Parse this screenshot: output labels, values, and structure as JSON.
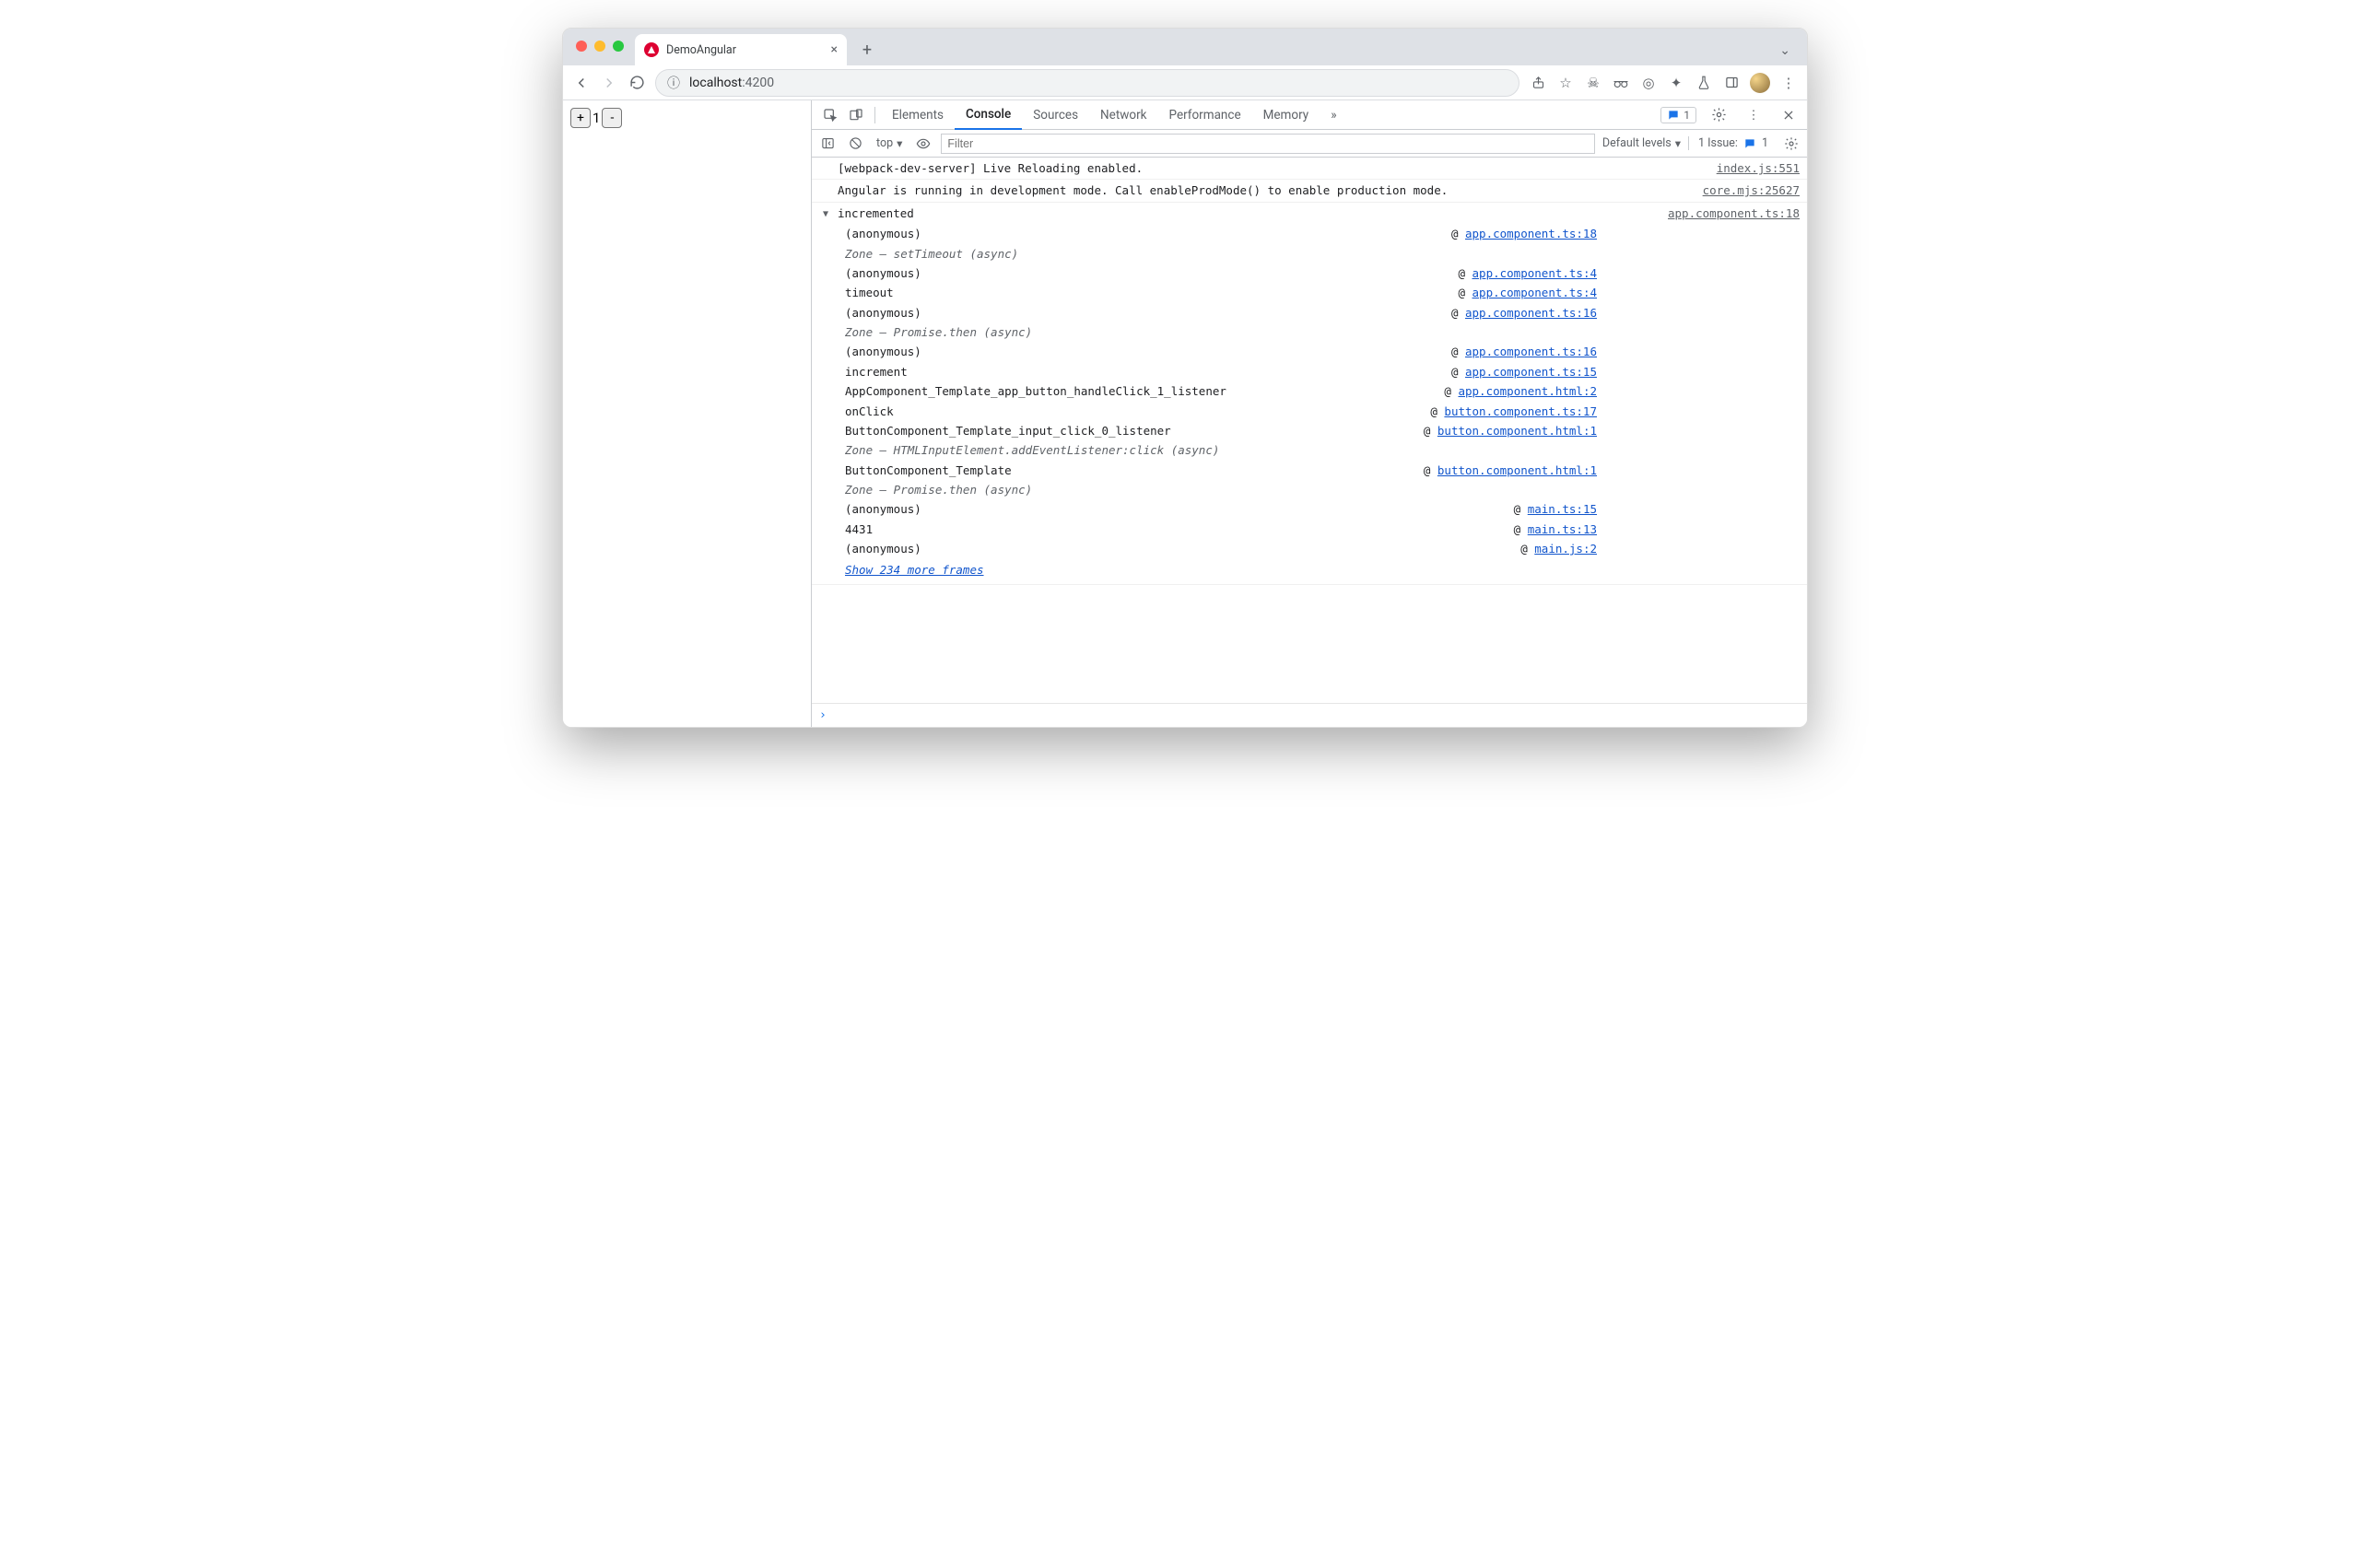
{
  "browser": {
    "tab_title": "DemoAngular",
    "url_host": "localhost",
    "url_rest": ":4200",
    "new_tab_glyph": "+",
    "close_glyph": "×"
  },
  "page": {
    "counter_value": "1",
    "plus_label": "+",
    "minus_label": "-"
  },
  "devtools": {
    "tabs": [
      "Elements",
      "Console",
      "Sources",
      "Network",
      "Performance",
      "Memory"
    ],
    "active_tab": "Console",
    "more_glyph": "»",
    "messages_count": "1",
    "filterbar": {
      "context_label": "top",
      "filter_placeholder": "Filter",
      "levels_label": "Default levels",
      "issues_prefix": "1 Issue:",
      "issues_count": "1"
    }
  },
  "console": {
    "msg1": {
      "text": "[webpack-dev-server] Live Reloading enabled.",
      "src": "index.js:551"
    },
    "msg2": {
      "text": "Angular is running in development mode. Call enableProdMode() to enable production mode.",
      "src": "core.mjs:25627"
    },
    "group_label": "incremented",
    "group_src": "app.component.ts:18",
    "trace": [
      {
        "fn": "(anonymous)",
        "link": "app.component.ts:18",
        "zone": false
      },
      {
        "fn": "Zone — setTimeout (async)",
        "link": "",
        "zone": true
      },
      {
        "fn": "(anonymous)",
        "link": "app.component.ts:4",
        "zone": false
      },
      {
        "fn": "timeout",
        "link": "app.component.ts:4",
        "zone": false
      },
      {
        "fn": "(anonymous)",
        "link": "app.component.ts:16",
        "zone": false
      },
      {
        "fn": "Zone — Promise.then (async)",
        "link": "",
        "zone": true
      },
      {
        "fn": "(anonymous)",
        "link": "app.component.ts:16",
        "zone": false
      },
      {
        "fn": "increment",
        "link": "app.component.ts:15",
        "zone": false
      },
      {
        "fn": "AppComponent_Template_app_button_handleClick_1_listener",
        "link": "app.component.html:2",
        "zone": false
      },
      {
        "fn": "onClick",
        "link": "button.component.ts:17",
        "zone": false
      },
      {
        "fn": "ButtonComponent_Template_input_click_0_listener",
        "link": "button.component.html:1",
        "zone": false
      },
      {
        "fn": "Zone — HTMLInputElement.addEventListener:click (async)",
        "link": "",
        "zone": true
      },
      {
        "fn": "ButtonComponent_Template",
        "link": "button.component.html:1",
        "zone": false
      },
      {
        "fn": "Zone — Promise.then (async)",
        "link": "",
        "zone": true
      },
      {
        "fn": "(anonymous)",
        "link": "main.ts:15",
        "zone": false
      },
      {
        "fn": "4431",
        "link": "main.ts:13",
        "zone": false
      },
      {
        "fn": "(anonymous)",
        "link": "main.js:2",
        "zone": false
      }
    ],
    "show_more": "Show 234 more frames",
    "prompt_glyph": "›"
  }
}
